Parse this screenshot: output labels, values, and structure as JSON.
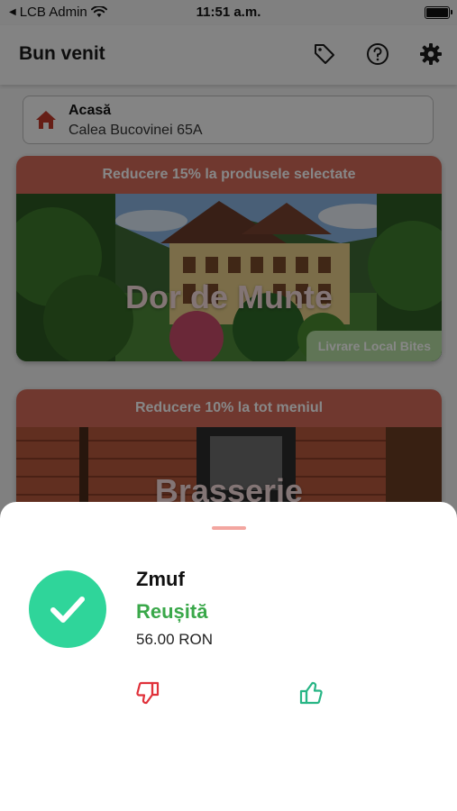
{
  "status_bar": {
    "carrier": "LCB Admin",
    "time": "11:51 a.m."
  },
  "header": {
    "title": "Bun venit",
    "icons": [
      "tag-icon",
      "help-icon",
      "gear-icon"
    ]
  },
  "address": {
    "label": "Acasă",
    "street": "Calea Bucovinei 65A"
  },
  "restaurants": [
    {
      "discount": "Reducere 15% la produsele selectate",
      "name": "Dor de Munte",
      "delivery": "Livrare Local Bites"
    },
    {
      "discount": "Reducere 10% la tot meniul",
      "name": "Brasserie"
    }
  ],
  "transaction": {
    "merchant": "Zmuf",
    "status": "Reușită",
    "amount": "56.00 RON"
  },
  "colors": {
    "accent": "#d36a5a",
    "success": "#2fd59a",
    "status_green": "#3aa84a",
    "thumbs_down": "#e0313a",
    "thumbs_up": "#27b585"
  }
}
